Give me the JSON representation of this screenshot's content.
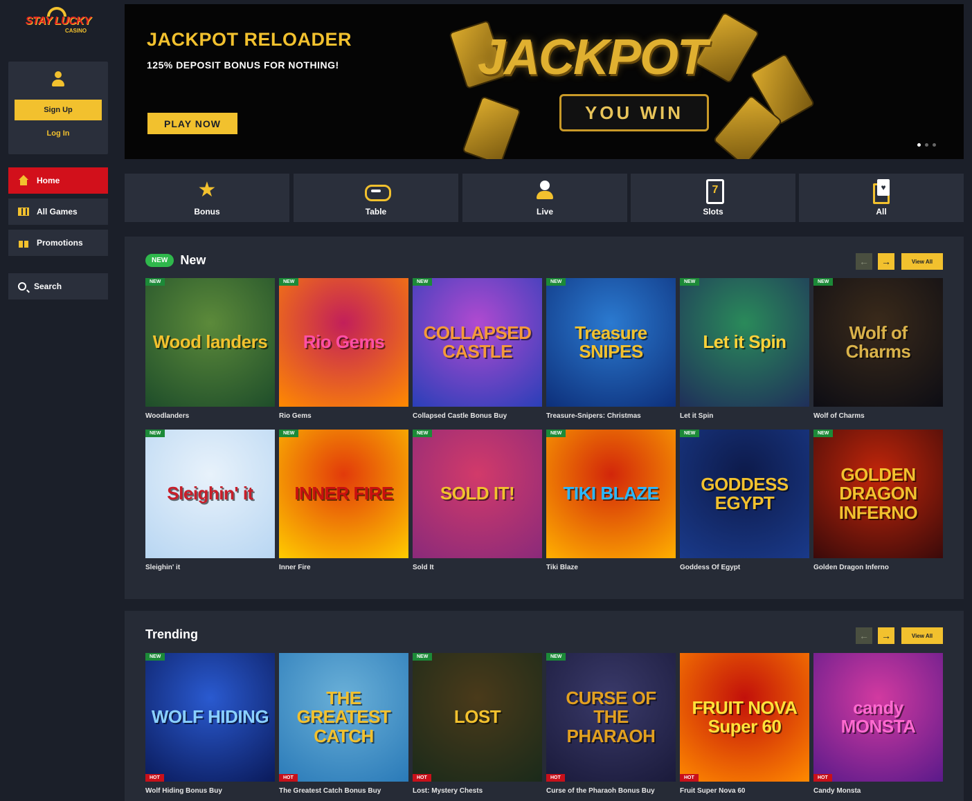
{
  "brand": {
    "name": "STAY LUCKY",
    "sub": "CASINO"
  },
  "account": {
    "signup_label": "Sign Up",
    "login_label": "Log In"
  },
  "nav": [
    {
      "label": "Home",
      "icon": "home-icon",
      "active": true
    },
    {
      "label": "All Games",
      "icon": "slot-machine-icon"
    },
    {
      "label": "Promotions",
      "icon": "gift-icon"
    },
    {
      "label": "Search",
      "icon": "search-icon"
    }
  ],
  "banner": {
    "title": "JACKPOT RELOADER",
    "subtitle": "125% DEPOSIT BONUS FOR NOTHING!",
    "cta": "PLAY NOW",
    "art_word": "JACKPOT",
    "art_sub": "YOU WIN"
  },
  "categories": [
    {
      "label": "Bonus",
      "icon": "star-icon"
    },
    {
      "label": "Table",
      "icon": "table-chip-icon"
    },
    {
      "label": "Live",
      "icon": "live-dealer-icon"
    },
    {
      "label": "Slots",
      "icon": "slot-seven-icon"
    },
    {
      "label": "All",
      "icon": "cards-icon"
    }
  ],
  "sections": {
    "new": {
      "pill": "NEW",
      "title": "New",
      "view_all": "View All",
      "games": [
        {
          "name": "Woodlanders",
          "art": "Wood landers",
          "badge": "NEW",
          "colors": [
            "#1e4d2a",
            "#5c8a3a"
          ],
          "fg": "#f2c12e"
        },
        {
          "name": "Rio Gems",
          "art": "Rio Gems",
          "badge": "NEW",
          "colors": [
            "#ff8a00",
            "#c21f5a"
          ],
          "fg": "#ff4fa6"
        },
        {
          "name": "Collapsed Castle Bonus Buy",
          "art": "COLLAPSED CASTLE",
          "badge": "NEW",
          "colors": [
            "#2a3fb8",
            "#b04ad0"
          ],
          "fg": "#f59a3a"
        },
        {
          "name": "Treasure-Snipers: Christmas",
          "art": "Treasure SNIPES",
          "badge": "NEW",
          "colors": [
            "#0d2f7a",
            "#2b7ad0"
          ],
          "fg": "#f2c12e"
        },
        {
          "name": "Let it Spin",
          "art": "Let it Spin",
          "badge": "NEW",
          "colors": [
            "#1f2f5a",
            "#2a8a5a"
          ],
          "fg": "#ffd23a"
        },
        {
          "name": "Wolf of Charms",
          "art": "Wolf of Charms",
          "badge": "NEW",
          "colors": [
            "#0d0d14",
            "#3a2a1a"
          ],
          "fg": "#d9b24a"
        },
        {
          "name": "Sleighin' it",
          "art": "Sleighin' it",
          "badge": "NEW",
          "colors": [
            "#b8d6f2",
            "#e8f2fb"
          ],
          "fg": "#c81e2a"
        },
        {
          "name": "Inner Fire",
          "art": "INNER FIRE",
          "badge": "NEW",
          "colors": [
            "#ffcc00",
            "#e23a0a"
          ],
          "fg": "#c81010"
        },
        {
          "name": "Sold It",
          "art": "SOLD IT!",
          "badge": "NEW",
          "colors": [
            "#8a2a7a",
            "#d23a6a"
          ],
          "fg": "#f2c12e"
        },
        {
          "name": "Tiki Blaze",
          "art": "TIKI BLAZE",
          "badge": "NEW",
          "colors": [
            "#ffb000",
            "#d2260a"
          ],
          "fg": "#2ab8ff"
        },
        {
          "name": "Goddess Of Egypt",
          "art": "GODDESS EGYPT",
          "badge": "NEW",
          "colors": [
            "#1a3a8a",
            "#0d1a4a"
          ],
          "fg": "#f2c12e"
        },
        {
          "name": "Golden Dragon Inferno",
          "art": "GOLDEN DRAGON INFERNO",
          "badge": "NEW",
          "colors": [
            "#3a0a0a",
            "#c2260a"
          ],
          "fg": "#f2c12e"
        }
      ]
    },
    "trending": {
      "title": "Trending",
      "view_all": "View All",
      "games": [
        {
          "name": "Wolf Hiding Bonus Buy",
          "art": "WOLF HIDING",
          "badge": "NEW",
          "hot": "HOT",
          "colors": [
            "#0a1a5a",
            "#2a5ad0"
          ],
          "fg": "#8ad0ff"
        },
        {
          "name": "The Greatest Catch Bonus Buy",
          "art": "THE GREATEST CATCH",
          "badge": "",
          "hot": "HOT",
          "colors": [
            "#2a7ab8",
            "#6ab0d8"
          ],
          "fg": "#f2c12e"
        },
        {
          "name": "Lost: Mystery Chests",
          "art": "LOST",
          "badge": "NEW",
          "hot": "HOT",
          "colors": [
            "#1a2a1a",
            "#4a3a1a"
          ],
          "fg": "#f2c12e"
        },
        {
          "name": "Curse of the Pharaoh Bonus Buy",
          "art": "CURSE OF THE PHARAOH",
          "badge": "NEW",
          "hot": "HOT",
          "colors": [
            "#1a1a3a",
            "#3a3a6a"
          ],
          "fg": "#e2a020"
        },
        {
          "name": "Fruit Super Nova 60",
          "art": "FRUIT NOVA Super 60",
          "badge": "",
          "hot": "HOT",
          "colors": [
            "#ff8a00",
            "#c2100a"
          ],
          "fg": "#ffe23a"
        },
        {
          "name": "Candy Monsta",
          "art": "candy MONSTA",
          "badge": "",
          "hot": "HOT",
          "colors": [
            "#5a1a8a",
            "#d23aa0"
          ],
          "fg": "#ff6ad0"
        }
      ]
    }
  }
}
